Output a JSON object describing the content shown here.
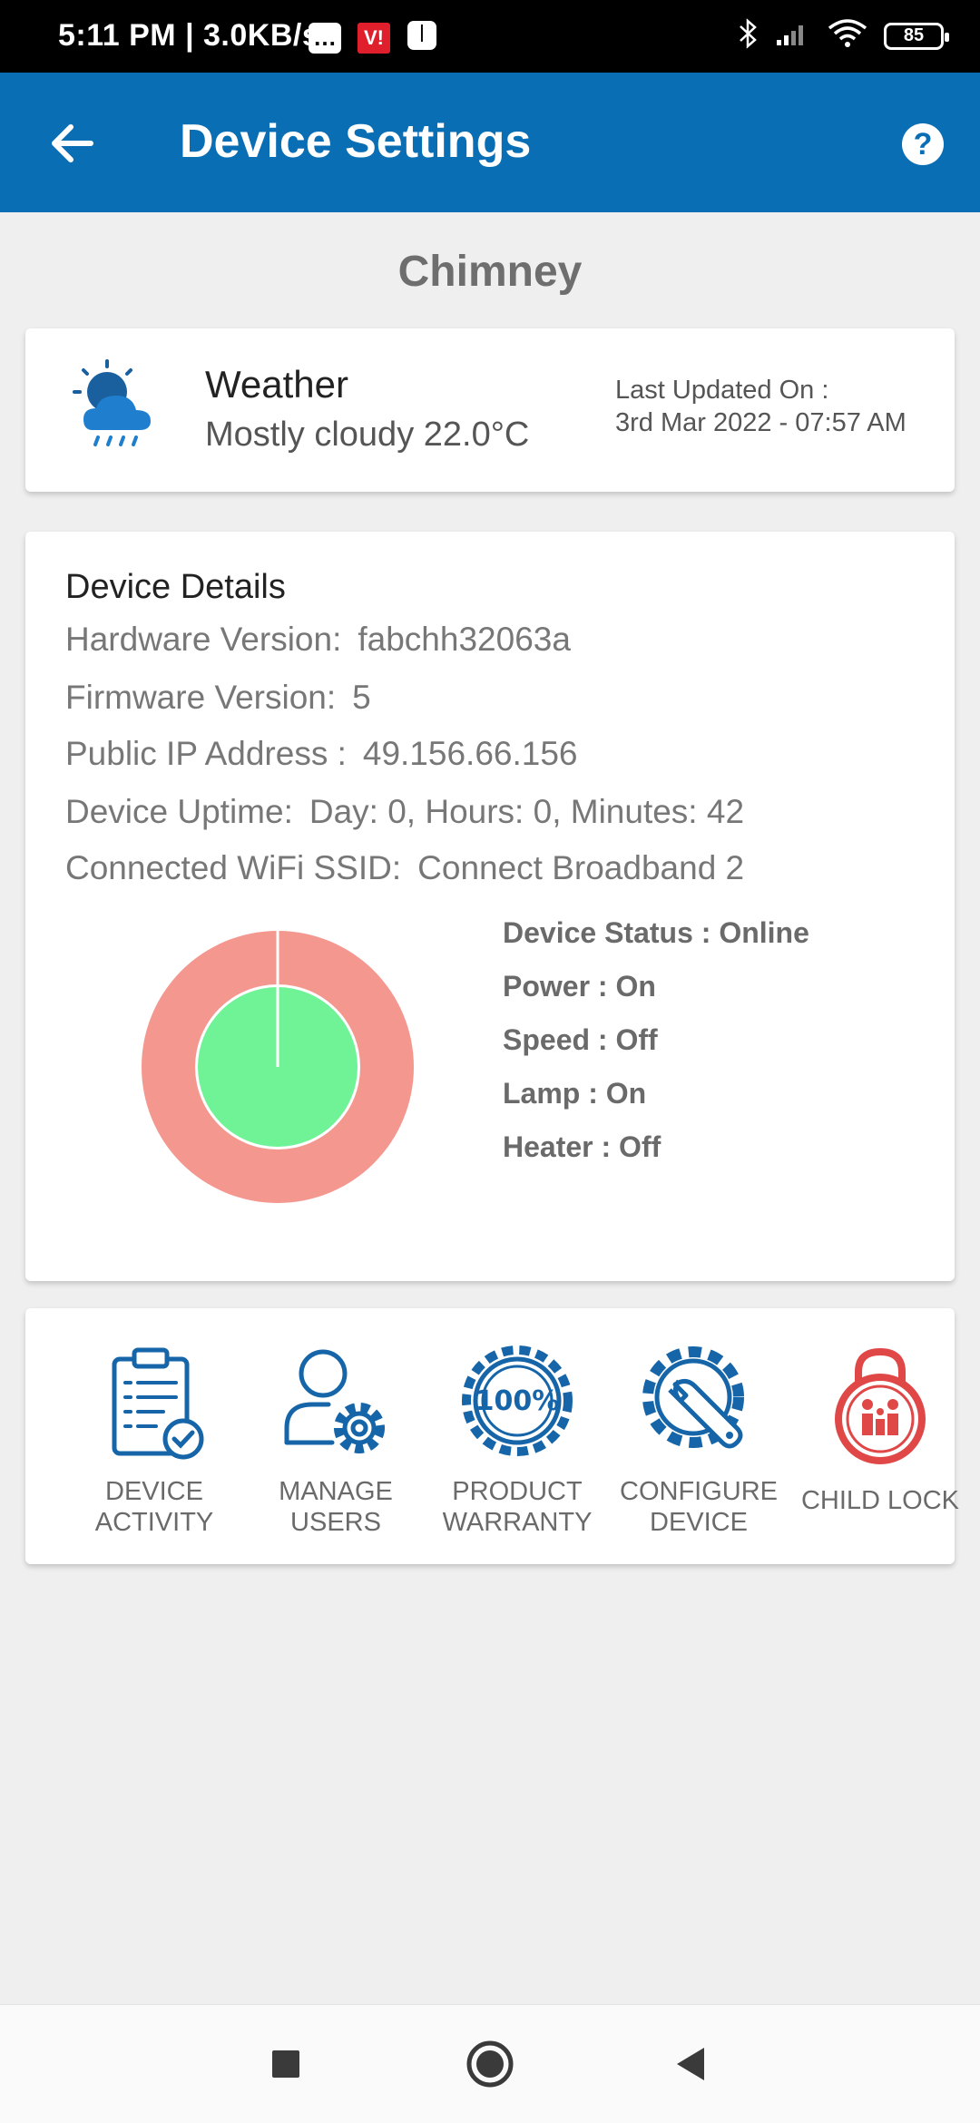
{
  "status_bar": {
    "time": "5:11 PM | 3.0KB/s",
    "carrier_badge": "V!",
    "message_badge": "…",
    "battery": "85"
  },
  "app_bar": {
    "title": "Device Settings",
    "help_label": "?"
  },
  "device_name": "Chimney",
  "weather": {
    "title": "Weather",
    "description": "Mostly cloudy 22.0°C",
    "last_updated_label": "Last Updated On :",
    "last_updated_value": "3rd Mar 2022 - 07:57 AM"
  },
  "device_details": {
    "heading": "Device Details",
    "rows": [
      {
        "label": "Hardware Version:",
        "value": "fabchh32063a"
      },
      {
        "label": "Firmware Version:",
        "value": "5"
      },
      {
        "label": "Public IP Address :",
        "value": "49.156.66.156"
      },
      {
        "label": "Device Uptime:",
        "value": "Day: 0, Hours: 0, Minutes: 42"
      },
      {
        "label": "Connected WiFi SSID:",
        "value": "Connect Broadband 2"
      }
    ],
    "status": [
      "Device Status : Online",
      "Power : On",
      "Speed : Off",
      "Lamp : On",
      "Heater : Off"
    ],
    "chart_colors": {
      "outer": "#f4978e",
      "inner": "#6ff396",
      "divider": "#ffffff"
    }
  },
  "actions": [
    {
      "line1": "DEVICE",
      "line2": "ACTIVITY"
    },
    {
      "line1": "MANAGE",
      "line2": "USERS"
    },
    {
      "line1": "PRODUCT",
      "line2": "WARRANTY"
    },
    {
      "line1": "CONFIGURE",
      "line2": "DEVICE"
    },
    {
      "line1": "CHILD LOCK",
      "line2": ""
    }
  ],
  "colors": {
    "primary": "#0a6eb4",
    "icon_blue": "#1565a8",
    "child_lock_red": "#e04848"
  }
}
